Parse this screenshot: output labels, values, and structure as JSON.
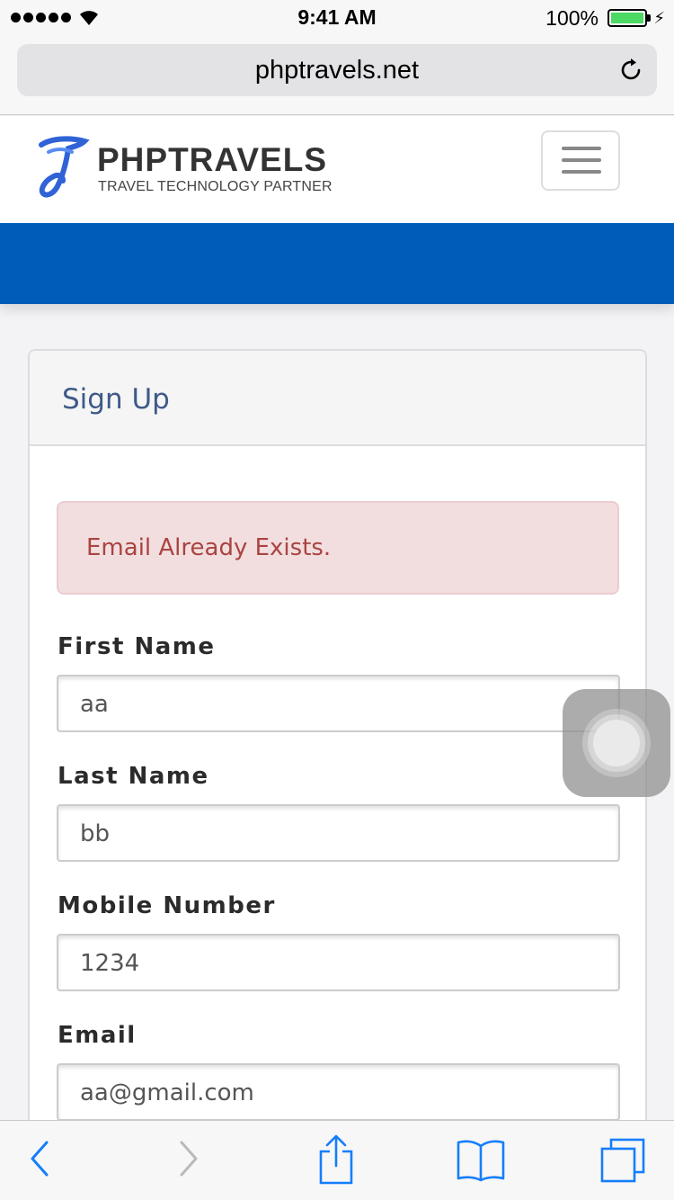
{
  "status_bar": {
    "time": "9:41 AM",
    "battery_percent": "100%",
    "signal_bars": 5,
    "icons": [
      "signal-dots-icon",
      "wifi-icon",
      "battery-icon",
      "charging-bolt-icon"
    ]
  },
  "browser": {
    "url": "phptravels.net",
    "reload_icon": "reload-icon"
  },
  "site_header": {
    "brand_title": "PHPTRAVELS",
    "brand_tagline": "TRAVEL TECHNOLOGY PARTNER",
    "menu_icon": "hamburger-icon",
    "band_color": "#005cb9"
  },
  "signup": {
    "title": "Sign Up",
    "alert": "Email Already Exists.",
    "fields": [
      {
        "label": "First Name",
        "value": "aa"
      },
      {
        "label": "Last Name",
        "value": "bb"
      },
      {
        "label": "Mobile Number",
        "value": "1234"
      },
      {
        "label": "Email",
        "value": "aa@gmail.com"
      }
    ]
  },
  "toolbar": {
    "icons": [
      "back-icon",
      "forward-icon",
      "share-icon",
      "bookmarks-icon",
      "tabs-icon"
    ],
    "accent": "#157efb"
  }
}
